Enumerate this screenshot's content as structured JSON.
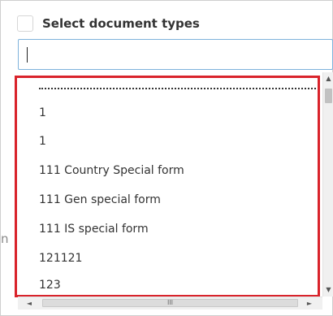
{
  "header": {
    "label": "Select document types",
    "checked": false
  },
  "search": {
    "value": "",
    "placeholder": ""
  },
  "side_text": "n",
  "list": {
    "items": [
      "1",
      "1",
      "111 Country Special form",
      "111 Gen special form",
      "111 IS special form",
      "121121",
      "123"
    ]
  },
  "scrollbars": {
    "vertical_up": "▲",
    "vertical_down": "▼",
    "horizontal_left": "◄",
    "horizontal_right": "►",
    "horizontal_grip": "III"
  },
  "colors": {
    "highlight": "#d9232b",
    "focus_border": "#7eb3dc"
  }
}
